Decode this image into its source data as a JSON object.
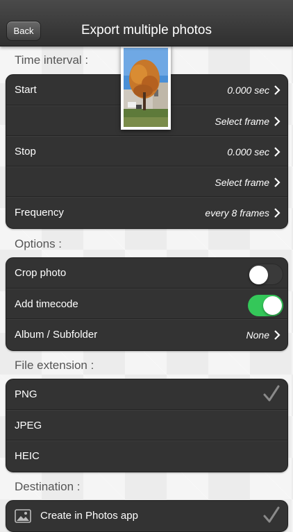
{
  "nav": {
    "back_label": "Back",
    "title": "Export multiple photos"
  },
  "sections": {
    "time_interval": "Time interval :",
    "options": "Options :",
    "file_extension": "File extension :",
    "destination": "Destination :"
  },
  "time_interval": {
    "start_label": "Start",
    "start_value": "0.000 sec",
    "start_select": "Select frame",
    "stop_label": "Stop",
    "stop_value": "0.000 sec",
    "stop_select": "Select frame",
    "frequency_label": "Frequency",
    "frequency_value": "every 8 frames"
  },
  "options": {
    "crop_label": "Crop photo",
    "crop_on": false,
    "timecode_label": "Add timecode",
    "timecode_on": true,
    "album_label": "Album / Subfolder",
    "album_value": "None"
  },
  "file_extension": {
    "items": [
      "PNG",
      "JPEG",
      "HEIC"
    ],
    "selected": "PNG"
  },
  "destination": {
    "create_label": "Create in Photos app"
  },
  "colors": {
    "toggle_on": "#34c759",
    "cell_bg": "#333333",
    "nav_bg": "#3a3a3a"
  }
}
